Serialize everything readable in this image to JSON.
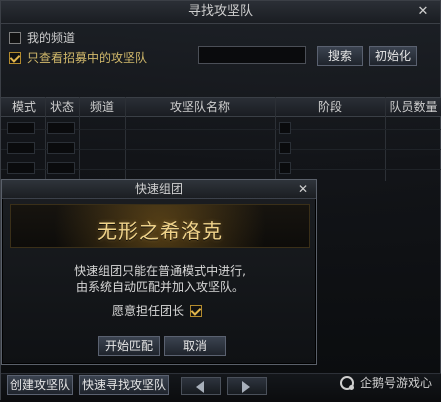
{
  "window": {
    "title": "寻找攻坚队"
  },
  "filters": {
    "my_channel": {
      "label": "我的频道",
      "checked": false
    },
    "recruiting_only": {
      "label": "只查看招募中的攻坚队",
      "checked": true
    },
    "search_input": {
      "value": "",
      "placeholder": ""
    },
    "search_button": "搜索",
    "reset_button": "初始化"
  },
  "table": {
    "headers": [
      "模式",
      "状态",
      "频道",
      "攻坚队名称",
      "阶段",
      "队员数量"
    ]
  },
  "modal": {
    "title": "快速组团",
    "banner": "无形之希洛克",
    "message_lines": [
      "快速组团只能在普通模式中进行,",
      "由系统自动匹配并加入攻坚队。"
    ],
    "leader_option": {
      "label": "愿意担任团长",
      "checked": true
    },
    "buttons": {
      "start": "开始匹配",
      "cancel": "取消"
    }
  },
  "bottom": {
    "create_button": "创建攻坚队",
    "quick_find_button": "快速寻找攻坚队"
  },
  "watermark": {
    "text": "企鹅号游戏心"
  }
}
